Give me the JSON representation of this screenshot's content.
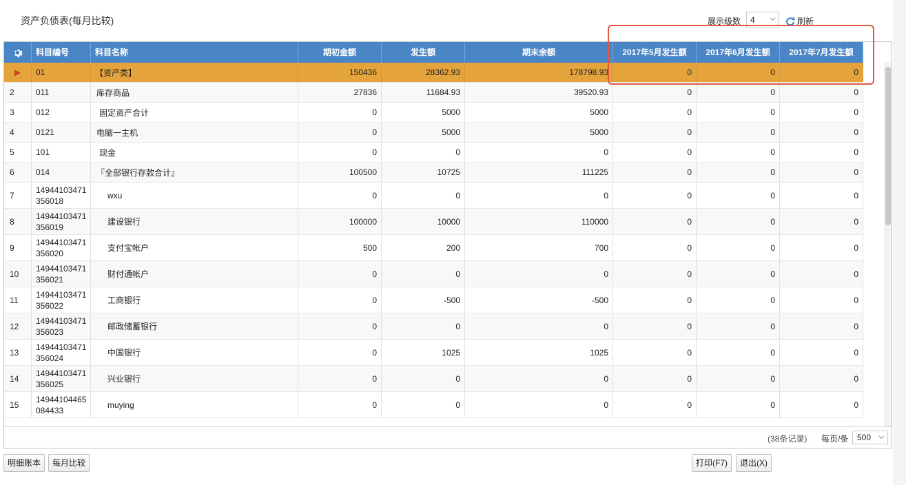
{
  "title": "资产负债表(每月比较)",
  "toolbar": {
    "level_label": "展示级数",
    "level_value": "4",
    "refresh_label": "刷新"
  },
  "grid": {
    "columns": [
      "科目编号",
      "科目名称",
      "期初金额",
      "发生额",
      "期末余额",
      "2017年5月发生额",
      "2017年6月发生额",
      "2017年7月发生额"
    ],
    "selected_marker": "▶",
    "rows": [
      {
        "no": "1",
        "code": "01",
        "name": "【资产类】",
        "begin": "150436",
        "occ": "28362.93",
        "end": "178798.93",
        "m5": "0",
        "m6": "0",
        "m7": "0"
      },
      {
        "no": "2",
        "code": "011",
        "name": "库存商品",
        "begin": "27836",
        "occ": "11684.93",
        "end": "39520.93",
        "m5": "0",
        "m6": "0",
        "m7": "0"
      },
      {
        "no": "3",
        "code": "012",
        "name": "固定资产合计",
        "begin": "0",
        "occ": "5000",
        "end": "5000",
        "m5": "0",
        "m6": "0",
        "m7": "0"
      },
      {
        "no": "4",
        "code": "0121",
        "name": "电脑一主机",
        "begin": "0",
        "occ": "5000",
        "end": "5000",
        "m5": "0",
        "m6": "0",
        "m7": "0"
      },
      {
        "no": "5",
        "code": "101",
        "name": "现金",
        "begin": "0",
        "occ": "0",
        "end": "0",
        "m5": "0",
        "m6": "0",
        "m7": "0"
      },
      {
        "no": "6",
        "code": "014",
        "name": "『全部银行存款合计』",
        "begin": "100500",
        "occ": "10725",
        "end": "111225",
        "m5": "0",
        "m6": "0",
        "m7": "0"
      },
      {
        "no": "7",
        "code": "14944103471356018",
        "name": "wxu",
        "begin": "0",
        "occ": "0",
        "end": "0",
        "m5": "0",
        "m6": "0",
        "m7": "0"
      },
      {
        "no": "8",
        "code": "14944103471356019",
        "name": "建设银行",
        "begin": "100000",
        "occ": "10000",
        "end": "110000",
        "m5": "0",
        "m6": "0",
        "m7": "0"
      },
      {
        "no": "9",
        "code": "14944103471356020",
        "name": "支付宝帐户",
        "begin": "500",
        "occ": "200",
        "end": "700",
        "m5": "0",
        "m6": "0",
        "m7": "0"
      },
      {
        "no": "10",
        "code": "14944103471356021",
        "name": "财付通帐户",
        "begin": "0",
        "occ": "0",
        "end": "0",
        "m5": "0",
        "m6": "0",
        "m7": "0"
      },
      {
        "no": "11",
        "code": "14944103471356022",
        "name": "工商银行",
        "begin": "0",
        "occ": "-500",
        "end": "-500",
        "m5": "0",
        "m6": "0",
        "m7": "0"
      },
      {
        "no": "12",
        "code": "14944103471356023",
        "name": "邮政储蓄银行",
        "begin": "0",
        "occ": "0",
        "end": "0",
        "m5": "0",
        "m6": "0",
        "m7": "0"
      },
      {
        "no": "13",
        "code": "14944103471356024",
        "name": "中国银行",
        "begin": "0",
        "occ": "1025",
        "end": "1025",
        "m5": "0",
        "m6": "0",
        "m7": "0"
      },
      {
        "no": "14",
        "code": "14944103471356025",
        "name": "兴业银行",
        "begin": "0",
        "occ": "0",
        "end": "0",
        "m5": "0",
        "m6": "0",
        "m7": "0"
      },
      {
        "no": "15",
        "code": "14944104465084433",
        "name": "muying",
        "begin": "0",
        "occ": "0",
        "end": "0",
        "m5": "0",
        "m6": "0",
        "m7": "0"
      }
    ]
  },
  "pager": {
    "record_count": "(38条记录)",
    "per_page_label": "每页/条",
    "per_page_value": "500"
  },
  "buttons": {
    "detail_ledger": "明细账本",
    "monthly_compare": "每月比较",
    "print": "打印(F7)",
    "exit": "退出(X)"
  },
  "colors": {
    "header_bg": "#4a86c5",
    "selected_row": "#e5a33c",
    "highlight_border": "#e4573f"
  }
}
